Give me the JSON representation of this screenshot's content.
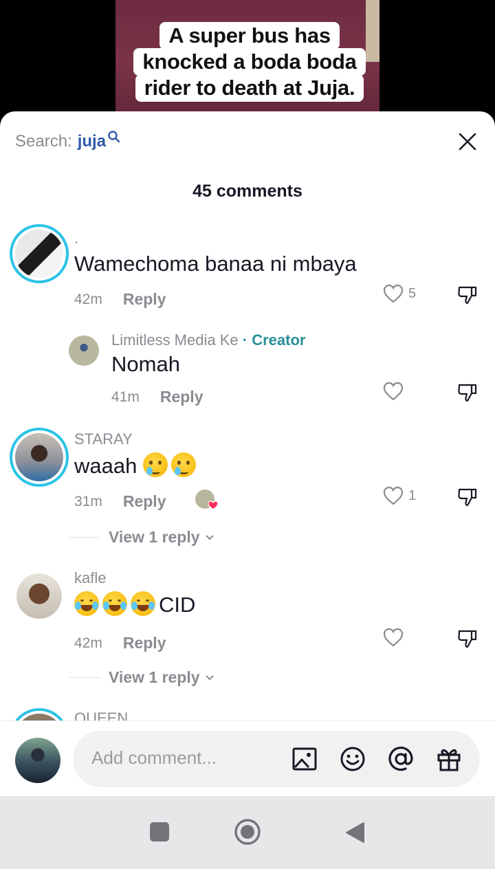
{
  "video": {
    "caption_lines": [
      "A super bus has",
      "knocked a boda boda",
      "rider to death at Juja."
    ]
  },
  "sheet": {
    "search_label": "Search:",
    "search_term": "juja",
    "title": "45 comments"
  },
  "comments": [
    {
      "username": ".",
      "text": "Wamechoma banaa ni mbaya",
      "time": "42m",
      "reply_label": "Reply",
      "likes": "5"
    },
    {
      "username": "Limitless Media Ke",
      "creator_label": "· Creator",
      "text": "Nomah",
      "time": "41m",
      "reply_label": "Reply"
    },
    {
      "username": "STARAY",
      "text": "waaah",
      "emojis": [
        "crying-face",
        "crying-face"
      ],
      "time": "31m",
      "reply_label": "Reply",
      "likes": "1",
      "view_replies": "View 1 reply"
    },
    {
      "username": "kafle",
      "emojis": [
        "tears-of-joy",
        "tears-of-joy",
        "tears-of-joy"
      ],
      "text_after_emoji": "CID",
      "time": "42m",
      "reply_label": "Reply",
      "view_replies": "View 1 reply"
    },
    {
      "username": "QUEEN"
    }
  ],
  "input": {
    "placeholder": "Add comment..."
  },
  "colors": {
    "accent_ring": "#2bc3e6",
    "search_term": "#2f5aa8",
    "creator": "#2a8f98",
    "secondary_text": "#8a8b91"
  },
  "icons": [
    "search-icon",
    "close-icon",
    "heart-icon",
    "dislike-icon",
    "chevron-down-icon",
    "image-icon",
    "emoji-icon",
    "mention-icon",
    "gift-icon",
    "nav-recents-icon",
    "nav-home-icon",
    "nav-back-icon"
  ]
}
